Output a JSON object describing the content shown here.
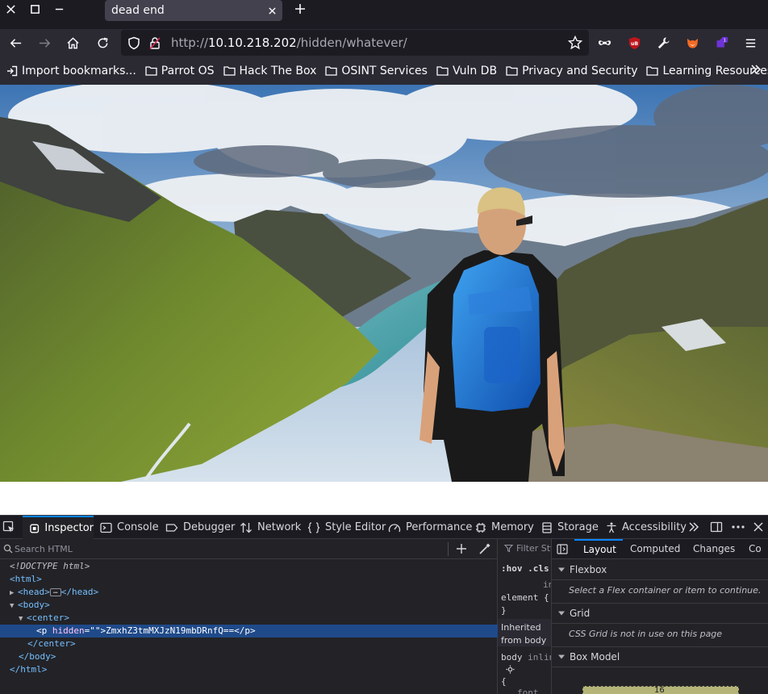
{
  "browser": {
    "tab": {
      "title": "dead end"
    },
    "url": {
      "scheme": "http://",
      "host": "10.10.218.202",
      "path": "/hidden/whatever/"
    },
    "extensions_badge": "1",
    "bookmarks": [
      {
        "label": "Import bookmarks...",
        "icon": "import-icon"
      },
      {
        "label": "Parrot OS",
        "icon": "folder-icon"
      },
      {
        "label": "Hack The Box",
        "icon": "folder-icon"
      },
      {
        "label": "OSINT Services",
        "icon": "folder-icon"
      },
      {
        "label": "Vuln DB",
        "icon": "folder-icon"
      },
      {
        "label": "Privacy and Security",
        "icon": "folder-icon"
      },
      {
        "label": "Learning Resources",
        "icon": "folder-icon"
      }
    ]
  },
  "devtools": {
    "tabs": [
      "Inspector",
      "Console",
      "Debugger",
      "Network",
      "Style Editor",
      "Performance",
      "Memory",
      "Storage",
      "Accessibility"
    ],
    "active_tab": "Inspector",
    "search_placeholder": "Search HTML",
    "tree": {
      "doctype": "<!DOCTYPE html>",
      "html_open": "<html>",
      "head_open": "<head>",
      "head_close": "</head>",
      "body_open": "<body>",
      "center_open": "<center>",
      "p_open": "<p",
      "p_attr": "hidden",
      "p_eq": "=\"",
      "p_val": "",
      "p_endattr": "\">",
      "p_text": "ZmxhZ3tmMXJzN19mbDRnfQ==",
      "p_close": "</p>",
      "center_close": "</center>",
      "body_close": "</body>",
      "html_close": "</html>"
    },
    "rules": {
      "filter_placeholder": "Filter Styles",
      "hov_cls": ":hov .cls",
      "inline_label": "inline",
      "element_selector": "element {",
      "close_brace": "}",
      "inherited_label": "Inherited from body",
      "body_selector": "body",
      "body_inline": "inline",
      "open_brace": "{",
      "font_prop": "font"
    },
    "layout": {
      "tabs": [
        "Layout",
        "Computed",
        "Changes",
        "Co"
      ],
      "active_tab": "Layout",
      "flexbox_title": "Flexbox",
      "flexbox_msg": "Select a Flex container or item to continue.",
      "grid_title": "Grid",
      "grid_msg": "CSS Grid is not in use on this page",
      "boxmodel_title": "Box Model",
      "boxmodel_value": "16"
    }
  },
  "colors": {
    "accent": "#0a84ff",
    "selection": "#1f4a8a",
    "toolbar": "#2b2a33",
    "frame": "#1c1b22"
  }
}
